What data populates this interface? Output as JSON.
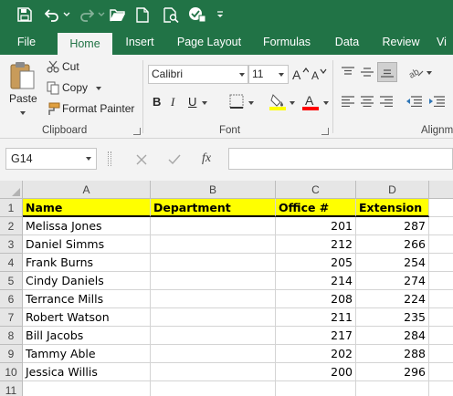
{
  "colors": {
    "brand": "#217346",
    "header_fill": "#ffff00",
    "ribbon_bg": "#f3f3f3"
  },
  "qat": {
    "icons": [
      "save-icon",
      "undo-icon",
      "redo-icon",
      "open-folder-icon",
      "new-document-icon",
      "print-preview-icon",
      "touch-mode-icon",
      "customize-qat-icon"
    ]
  },
  "tabs": [
    {
      "label": "File"
    },
    {
      "label": "Home"
    },
    {
      "label": "Insert"
    },
    {
      "label": "Page Layout"
    },
    {
      "label": "Formulas"
    },
    {
      "label": "Data"
    },
    {
      "label": "Review"
    },
    {
      "label": "Vi"
    }
  ],
  "active_tab": "Home",
  "clipboard": {
    "paste": "Paste",
    "cut": "Cut",
    "copy": "Copy",
    "format_painter": "Format Painter",
    "group_label": "Clipboard"
  },
  "font": {
    "name": "Calibri",
    "size": "11",
    "group_label": "Font",
    "bold": "B",
    "italic": "I",
    "underline": "U",
    "fill_color": "#ffff00",
    "font_color": "#ff0000"
  },
  "alignment": {
    "group_label": "Alignm"
  },
  "formula_bar": {
    "name_box": "G14",
    "fx": "fx",
    "value": ""
  },
  "sheet": {
    "columns": [
      "A",
      "B",
      "C",
      "D"
    ],
    "row_numbers": [
      "1",
      "2",
      "3",
      "4",
      "5",
      "6",
      "7",
      "8",
      "9",
      "10",
      "11"
    ],
    "headers": [
      "Name",
      "Department",
      "Office #",
      "Extension"
    ],
    "rows": [
      [
        "Melissa Jones",
        "",
        "201",
        "287"
      ],
      [
        "Daniel Simms",
        "",
        "212",
        "266"
      ],
      [
        "Frank Burns",
        "",
        "205",
        "254"
      ],
      [
        "Cindy Daniels",
        "",
        "214",
        "274"
      ],
      [
        "Terrance Mills",
        "",
        "208",
        "224"
      ],
      [
        "Robert Watson",
        "",
        "211",
        "235"
      ],
      [
        "Bill Jacobs",
        "",
        "217",
        "284"
      ],
      [
        "Tammy Able",
        "",
        "202",
        "288"
      ],
      [
        "Jessica Willis",
        "",
        "200",
        "296"
      ],
      [
        "",
        "",
        "",
        ""
      ]
    ]
  }
}
